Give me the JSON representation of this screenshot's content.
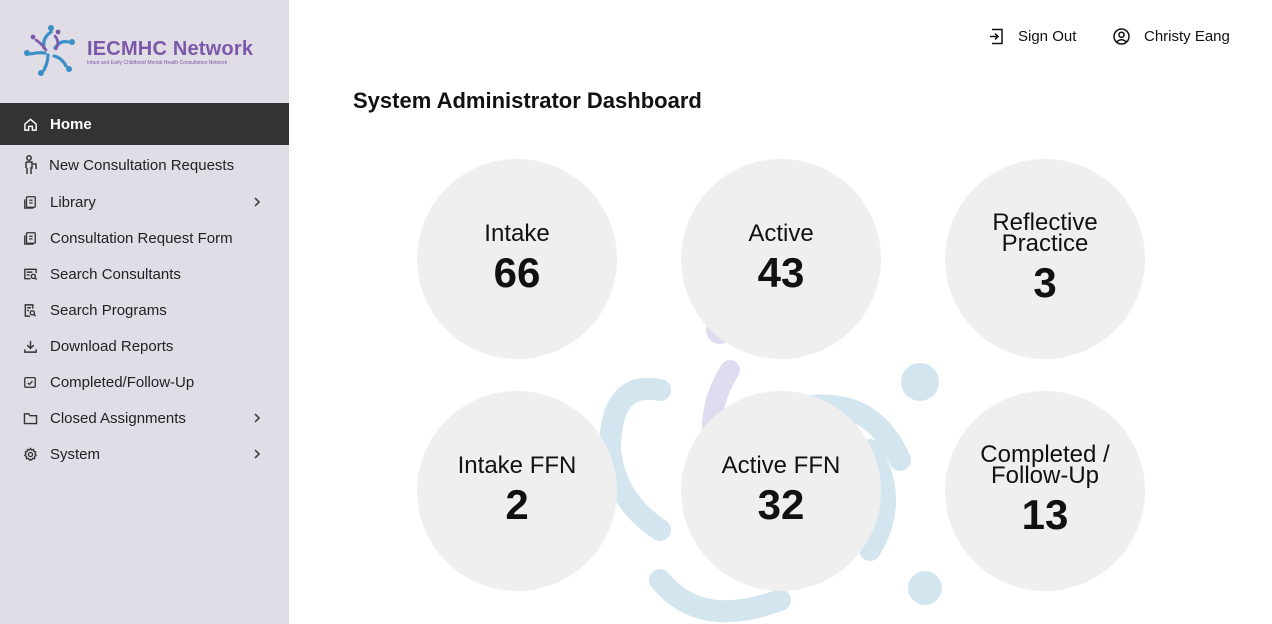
{
  "logo": {
    "title": "IECMHC Network",
    "subtitle": "Infant and Early Childhood Mental Health Consultation Network",
    "brand_color": "#7b59a8",
    "accent_color": "#3a8fc6"
  },
  "sidebar": {
    "items": [
      {
        "label": "Home",
        "icon": "home-icon",
        "active": true
      },
      {
        "label": "New Consultation Requests",
        "icon": "person-icon"
      },
      {
        "label": "Library",
        "icon": "book-icon",
        "has_submenu": true
      },
      {
        "label": "Consultation Request Form",
        "icon": "document-icon"
      },
      {
        "label": "Search Consultants",
        "icon": "search-card-icon"
      },
      {
        "label": "Search Programs",
        "icon": "search-doc-icon"
      },
      {
        "label": "Download Reports",
        "icon": "download-icon"
      },
      {
        "label": "Completed/Follow-Up",
        "icon": "calendar-check-icon"
      },
      {
        "label": "Closed Assignments",
        "icon": "folder-icon",
        "has_submenu": true
      },
      {
        "label": "System",
        "icon": "gear-icon",
        "has_submenu": true
      }
    ]
  },
  "header": {
    "sign_out": "Sign Out",
    "user_name": "Christy Eang"
  },
  "page": {
    "title": "System Administrator Dashboard"
  },
  "stats": [
    {
      "label": "Intake",
      "value": "66"
    },
    {
      "label": "Active",
      "value": "43"
    },
    {
      "label": "Reflective Practice",
      "value": "3"
    },
    {
      "label": "Intake FFN",
      "value": "2"
    },
    {
      "label": "Active FFN",
      "value": "32"
    },
    {
      "label": "Completed / Follow-Up",
      "value": "13"
    }
  ],
  "colors": {
    "sidebar_bg": "#e0dde6",
    "active_bg": "#333333",
    "circle_bg": "#efefef"
  }
}
